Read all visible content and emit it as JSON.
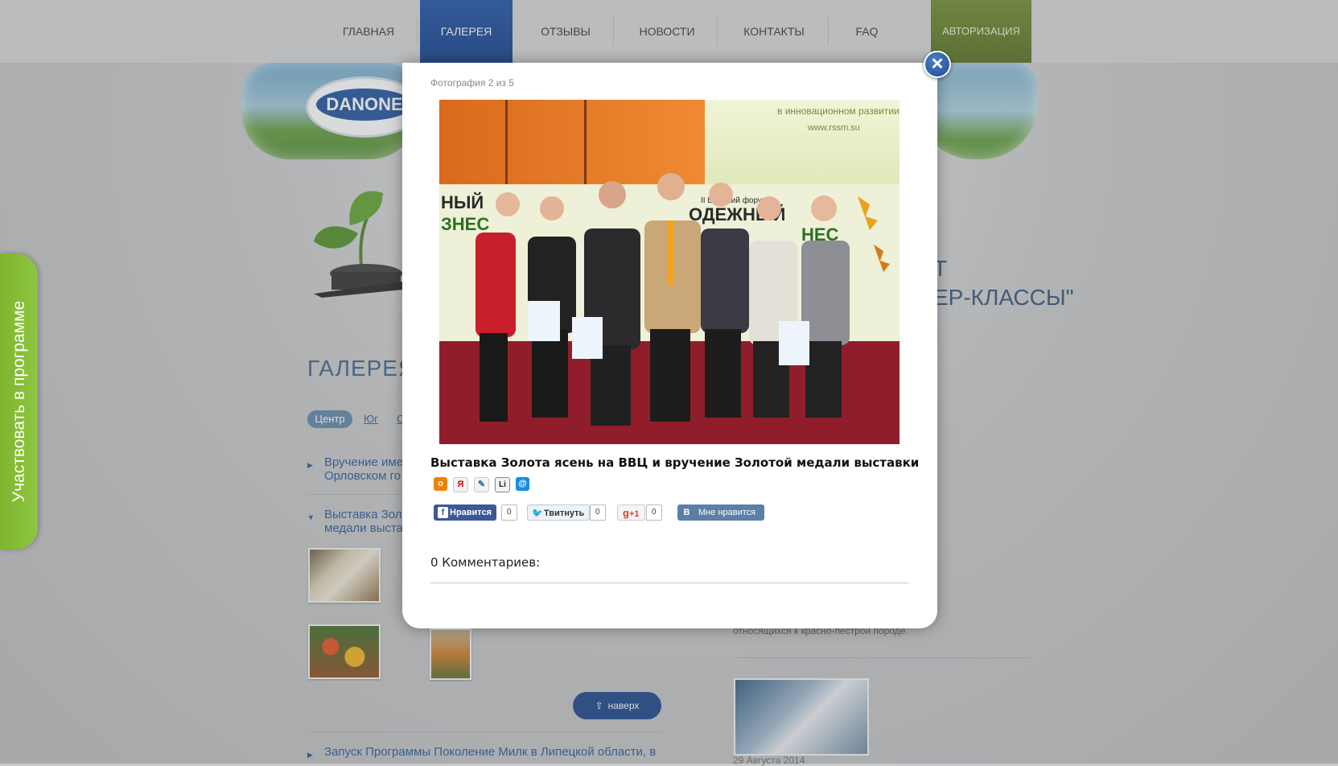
{
  "nav": {
    "items": [
      {
        "label": "ГЛАВНАЯ"
      },
      {
        "label": "ГАЛЕРЕЯ"
      },
      {
        "label": "ОТЗЫВЫ"
      },
      {
        "label": "НОВОСТИ"
      },
      {
        "label": "КОНТАКТЫ"
      },
      {
        "label": "FAQ"
      }
    ],
    "auth_label": "АВТОРИЗАЦИЯ",
    "active_index": 1
  },
  "background": {
    "logo_text": "DANONE",
    "heading_line1": "Т",
    "heading_line2": "ЕР-КЛАССЫ\"",
    "gallery_title": "ГАЛЕРЕЯ",
    "regions": [
      "Центр",
      "Юг",
      "С"
    ],
    "list": [
      {
        "line1": "Вручение име",
        "line2": "Орловском го"
      },
      {
        "line1": "Выставка Золо",
        "line2": "медали выста"
      },
      {
        "line1": "Запуск Программы Поколение Милк в Липецкой области, в",
        "line2": ""
      }
    ],
    "to_top_label": "наверх",
    "to_top_icon": "arrow-up-icon",
    "right_text": "относящихся к красно-пестрой породе.",
    "right_date": "29 Августа 2014",
    "participate_label": "Участвовать в программе"
  },
  "modal": {
    "counter": "Фотография 2 из 5",
    "photo_alt_banner": "в инновационном развитии",
    "photo_banner_url": "www.rssm.su",
    "photo_banner_text": "НЫЙ",
    "photo_banner_text2": "ЗНЕС",
    "photo_forum_text": "II Вс            йский форум",
    "photo_forum_big": "ОДЕЖНЫЙ",
    "photo_forum_big2": "НЕС",
    "caption": "Выставка Золота ясень на ВВЦ и вручение Золотой медали выставки",
    "share_icons": [
      {
        "name": "odnoklassniki-icon",
        "glyph": "о",
        "color": "#ee8208"
      },
      {
        "name": "yandex-icon",
        "glyph": "Я",
        "color": "#f2f2f2"
      },
      {
        "name": "livejournal-icon",
        "glyph": "✎",
        "color": "#f2f2f2"
      },
      {
        "name": "liveinternet-icon",
        "glyph": "Li",
        "color": "#f2f2f2"
      },
      {
        "name": "mailru-icon",
        "glyph": "@",
        "color": "#168de2"
      }
    ],
    "social": {
      "facebook_label": "Нравится",
      "facebook_count": "0",
      "twitter_label": "Твитнуть",
      "twitter_count": "0",
      "gplus_label": "+1",
      "gplus_count": "0",
      "vk_label": "Мне нравится",
      "vk_glyph": "В"
    },
    "comments_label": "0 Комментариев:",
    "close_glyph": "✕"
  },
  "colors": {
    "nav_active": "#0b3a8a",
    "nav_auth": "#5b7720",
    "link": "#22549c",
    "participate": "#8dc63f"
  }
}
